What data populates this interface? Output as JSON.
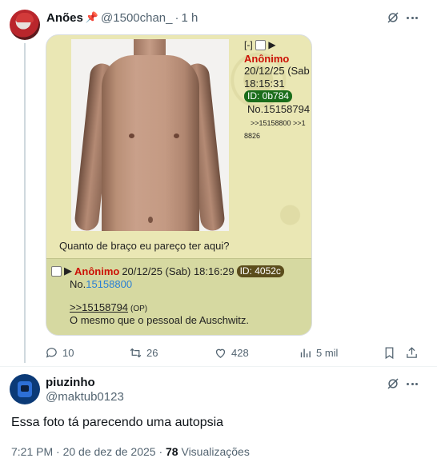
{
  "tweet1": {
    "display_name": "Anões",
    "pin_icon": "pin-icon",
    "handle": "@1500chan_",
    "separator": "·",
    "time": "1 h",
    "media": {
      "op": {
        "controls": "[-]",
        "play": "▶",
        "name": "Anônimo",
        "date": "20/12/25 (Sab",
        "time": "18:15:31",
        "id_tag": "ID: 0b784",
        "post_no": "No.15158794",
        "replies": ">>15158800  >>1",
        "replies2": "8826",
        "caption": "Quanto de braço eu pareço ter aqui?"
      },
      "reply": {
        "play": "▶",
        "name": "Anônimo",
        "datetime": "20/12/25 (Sab) 18:16:29",
        "id_tag": "ID: 4052c",
        "no_prefix": "No.",
        "post_no": "15158800",
        "quote": ">>15158794",
        "quote_op": "(OP)",
        "body": "O mesmo que o pessoal de Auschwitz."
      }
    },
    "actions": {
      "replies": "10",
      "retweets": "26",
      "likes": "428",
      "views": "5 mil"
    }
  },
  "tweet2": {
    "display_name": "piuzinho",
    "handle": "@maktub0123",
    "text": "Essa foto tá parecendo uma autopsia",
    "timestamp": "7:21 PM · 20 de dez de 2025 · ",
    "views_count": "78",
    "views_label": " Visualizações"
  }
}
